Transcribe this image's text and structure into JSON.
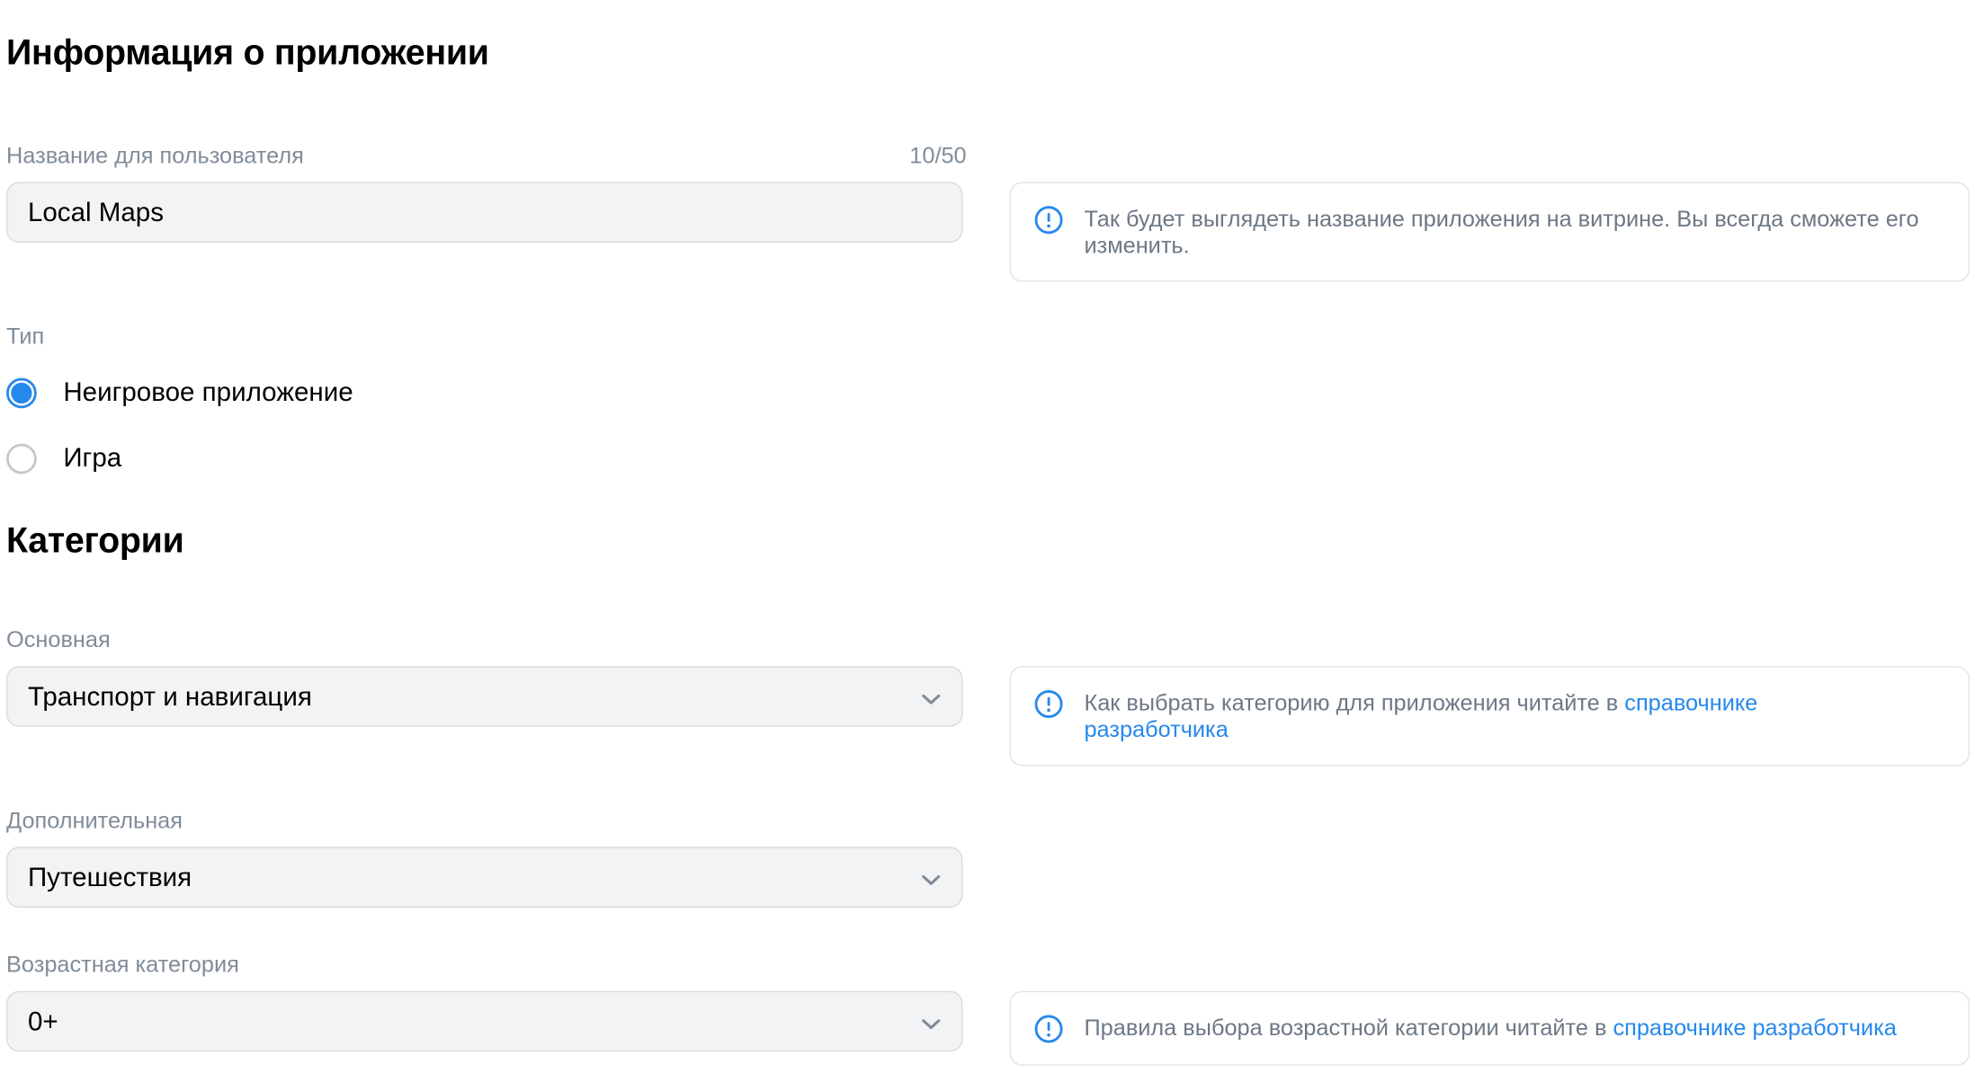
{
  "app_info": {
    "title": "Информация о приложении",
    "name_field": {
      "label": "Название для пользователя",
      "counter": "10/50",
      "value": "Local Maps",
      "hint": "Так будет выглядеть название приложения на витрине. Вы всегда сможете его изменить."
    },
    "type": {
      "label": "Тип",
      "options": [
        {
          "label": "Неигровое приложение",
          "selected": true
        },
        {
          "label": "Игра",
          "selected": false
        }
      ]
    }
  },
  "categories": {
    "title": "Категории",
    "primary": {
      "label": "Основная",
      "value": "Транспорт и навигация",
      "hint_text": "Как выбрать категорию для приложения читайте в ",
      "hint_link": "справочнике разработчика"
    },
    "secondary": {
      "label": "Дополнительная",
      "value": "Путешествия"
    },
    "age": {
      "label": "Возрастная категория",
      "value": "0+",
      "hint_text": "Правила выбора возрастной категории читайте в ",
      "hint_link": "справочнике разработчика"
    }
  },
  "icons": {
    "info": "info-circle-icon",
    "chevron": "chevron-down-icon",
    "radio": "radio-icon"
  },
  "colors": {
    "accent": "#2688eb",
    "label": "#818c99",
    "hint_text": "#6d7885",
    "field_bg": "#f2f3f5"
  }
}
